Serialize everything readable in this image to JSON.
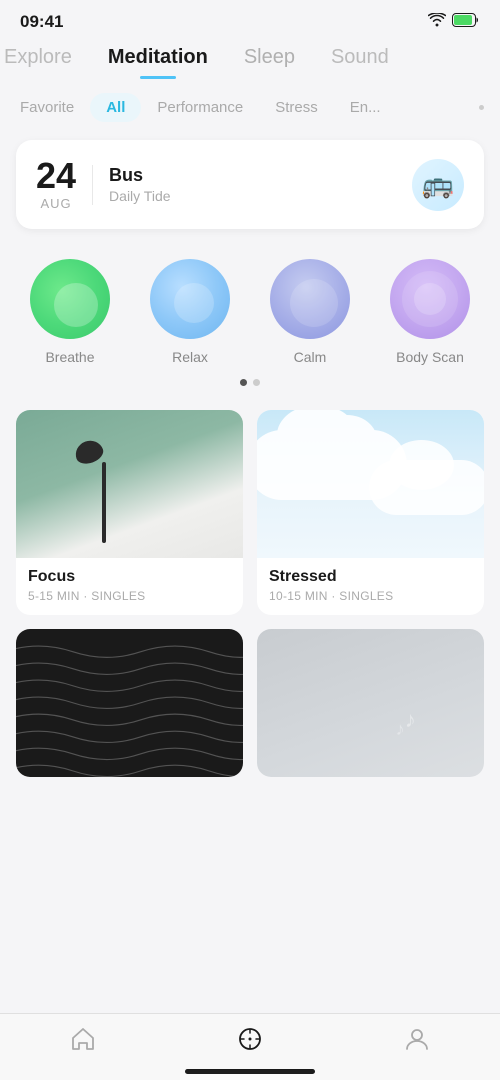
{
  "statusBar": {
    "time": "09:41"
  },
  "topNav": {
    "items": [
      {
        "id": "explore",
        "label": "Explore",
        "active": false,
        "partial": true
      },
      {
        "id": "meditation",
        "label": "Meditation",
        "active": true
      },
      {
        "id": "sleep",
        "label": "Sleep",
        "active": false
      },
      {
        "id": "sound",
        "label": "Sound",
        "active": false,
        "partial": true
      }
    ]
  },
  "filterTabs": {
    "items": [
      {
        "id": "favorite",
        "label": "Favorite",
        "active": false
      },
      {
        "id": "all",
        "label": "All",
        "active": true
      },
      {
        "id": "performance",
        "label": "Performance",
        "active": false
      },
      {
        "id": "stress",
        "label": "Stress",
        "active": false
      },
      {
        "id": "energy",
        "label": "En...",
        "active": false
      }
    ]
  },
  "dailyCard": {
    "day": "24",
    "month": "AUG",
    "title": "Bus",
    "subtitle": "Daily Tide",
    "illustration": "🚌"
  },
  "categories": [
    {
      "id": "breathe",
      "label": "Breathe",
      "style": "breathe"
    },
    {
      "id": "relax",
      "label": "Relax",
      "style": "relax"
    },
    {
      "id": "calm",
      "label": "Calm",
      "style": "calm"
    },
    {
      "id": "body-scan",
      "label": "Body Scan",
      "style": "bodyscan"
    }
  ],
  "contentCards": [
    {
      "id": "focus",
      "title": "Focus",
      "meta": "5-15 MIN · SINGLES",
      "imageType": "focus"
    },
    {
      "id": "stressed",
      "title": "Stressed",
      "meta": "10-15 MIN · SINGLES",
      "imageType": "stressed"
    },
    {
      "id": "waves",
      "title": "",
      "meta": "",
      "imageType": "black"
    },
    {
      "id": "calm2",
      "title": "",
      "meta": "",
      "imageType": "gray"
    }
  ],
  "bottomNav": {
    "items": [
      {
        "id": "home",
        "icon": "house",
        "active": false
      },
      {
        "id": "compass",
        "icon": "compass",
        "active": true
      },
      {
        "id": "profile",
        "icon": "person",
        "active": false
      }
    ]
  }
}
